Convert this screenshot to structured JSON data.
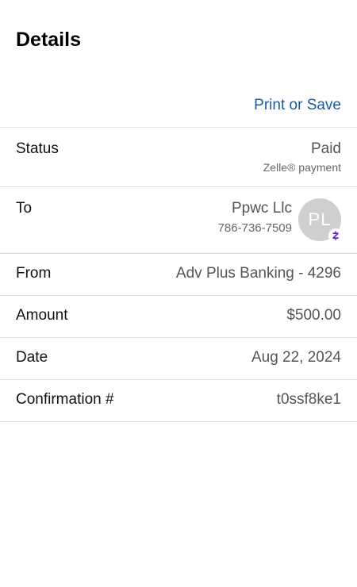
{
  "header": {
    "title": "Details",
    "print_label": "Print or Save"
  },
  "status": {
    "label": "Status",
    "value": "Paid",
    "sub": "Zelle® payment"
  },
  "to": {
    "label": "To",
    "name": "Ppwc Llc",
    "phone": "786-736-7509",
    "initials": "PL",
    "avatar_color": "#cfcfcf",
    "badge_icon": "zelle-icon",
    "badge_color": "#6d1ed4"
  },
  "from": {
    "label": "From",
    "value": "Adv Plus Banking - 4296"
  },
  "amount": {
    "label": "Amount",
    "value": "$500.00"
  },
  "date": {
    "label": "Date",
    "value": "Aug 22, 2024"
  },
  "confirmation": {
    "label": "Confirmation #",
    "value": "t0ssf8ke1"
  },
  "colors": {
    "link": "#1a5aa3",
    "divider": "#e2e2e2"
  }
}
